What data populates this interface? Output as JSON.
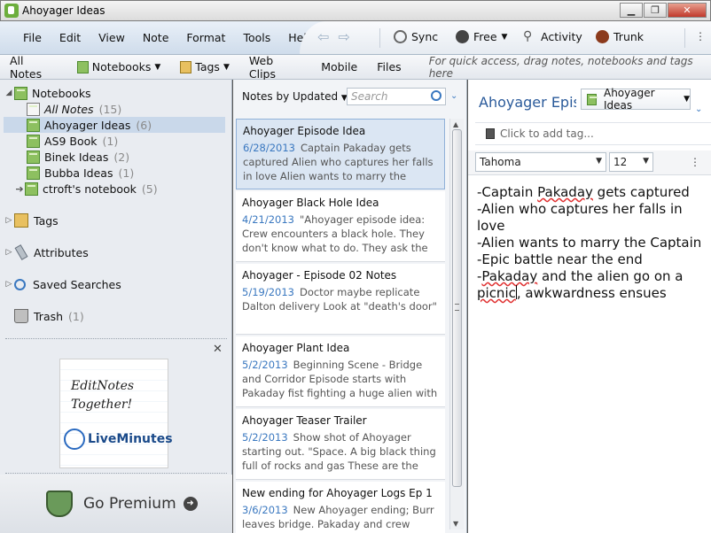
{
  "window": {
    "title": "Ahoyager Ideas"
  },
  "menu": [
    "File",
    "Edit",
    "View",
    "Note",
    "Format",
    "Tools",
    "Help"
  ],
  "toolbar": {
    "sync": "Sync",
    "account": "Free",
    "activity": "Activity",
    "trunk": "Trunk"
  },
  "shortcuts": {
    "all_notes": "All Notes",
    "notebooks": "Notebooks",
    "tags": "Tags",
    "web_clips": "Web Clips",
    "mobile": "Mobile",
    "files": "Files",
    "hint": "For quick access, drag notes, notebooks and tags here"
  },
  "sidebar": {
    "notebooks_label": "Notebooks",
    "items": [
      {
        "label": "All Notes",
        "count": "(15)"
      },
      {
        "label": "Ahoyager Ideas",
        "count": "(6)"
      },
      {
        "label": "AS9 Book",
        "count": "(1)"
      },
      {
        "label": "Binek Ideas",
        "count": "(2)"
      },
      {
        "label": "Bubba Ideas",
        "count": "(1)"
      },
      {
        "label": "ctroft's notebook",
        "count": "(5)"
      }
    ],
    "tags": "Tags",
    "attributes": "Attributes",
    "saved_searches": "Saved Searches",
    "trash": "Trash",
    "trash_count": "(1)",
    "ad_close": "✕",
    "ad_text": "EditNotes Together!",
    "ad_brand": "LiveMinutes",
    "premium": "Go Premium"
  },
  "notelist": {
    "sort": "Notes by Updated",
    "search_placeholder": "Search",
    "notes": [
      {
        "title": "Ahoyager Episode Idea",
        "date": "6/28/2013",
        "snippet": "Captain Pakaday gets captured Alien who captures her falls in love Alien wants to marry the Captain Epic battle n..."
      },
      {
        "title": "Ahoyager Black Hole Idea",
        "date": "4/21/2013",
        "snippet": "\"Ahoyager episode idea: Crew encounters a black hole. They don't know what to do. They ask the janitor for advi..."
      },
      {
        "title": "Ahoyager - Episode 02 Notes",
        "date": "5/19/2013",
        "snippet": "Doctor maybe replicate Dalton delivery Look at \"death's door\""
      },
      {
        "title": "Ahoyager Plant Idea",
        "date": "5/2/2013",
        "snippet": "Beginning Scene - Bridge and Corridor Episode starts with Pakaday fist fighting a huge alien with multiple tenac..."
      },
      {
        "title": "Ahoyager Teaser Trailer",
        "date": "5/2/2013",
        "snippet": "Show shot of Ahoyager starting out. \"Space. A big black thing full of rocks and gas These are the voyages of the sp..."
      },
      {
        "title": "New ending for Ahoyager Logs Ep 1",
        "date": "3/6/2013",
        "snippet": "New Ahoyager ending; Burr leaves bridge. Pakaday and crew monitor..."
      }
    ]
  },
  "editor": {
    "title": "Ahoyager Episc",
    "notebook": "Ahoyager Ideas",
    "tag_placeholder": "Click to add tag...",
    "font": "Tahoma",
    "size": "12",
    "lines": [
      {
        "pre": "-Captain ",
        "err": "Pakaday",
        "post": " gets captured"
      },
      {
        "pre": "-Alien who captures her falls in love",
        "err": "",
        "post": ""
      },
      {
        "pre": "-Alien wants to marry the Captain",
        "err": "",
        "post": ""
      },
      {
        "pre": "-Epic battle near the end",
        "err": "",
        "post": ""
      },
      {
        "pre": "-",
        "err": "Pakaday",
        "post": " and the alien go on a"
      },
      {
        "pre": "",
        "err": "picnic",
        "post": ", awkwardness ensues"
      }
    ]
  },
  "colors": {
    "accent": "#3a78c0",
    "title_blue": "#2a5a9a",
    "notebook_green": "#8dc060",
    "selection": "#c9d8ea"
  }
}
